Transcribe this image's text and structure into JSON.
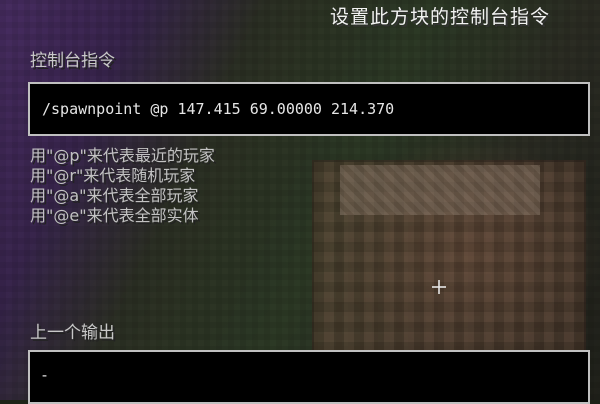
{
  "window": {
    "title": "设置此方块的控制台指令"
  },
  "command_section": {
    "label": "控制台指令",
    "value": "/spawnpoint @p 147.415 69.00000 214.370"
  },
  "hints": [
    "用\"@p\"来代表最近的玩家",
    "用\"@r\"来代表随机玩家",
    "用\"@a\"来代表全部玩家",
    "用\"@e\"来代表全部实体"
  ],
  "output_section": {
    "label": "上一个输出",
    "value": "-"
  },
  "icons": {
    "crosshair": "crosshair-icon"
  }
}
